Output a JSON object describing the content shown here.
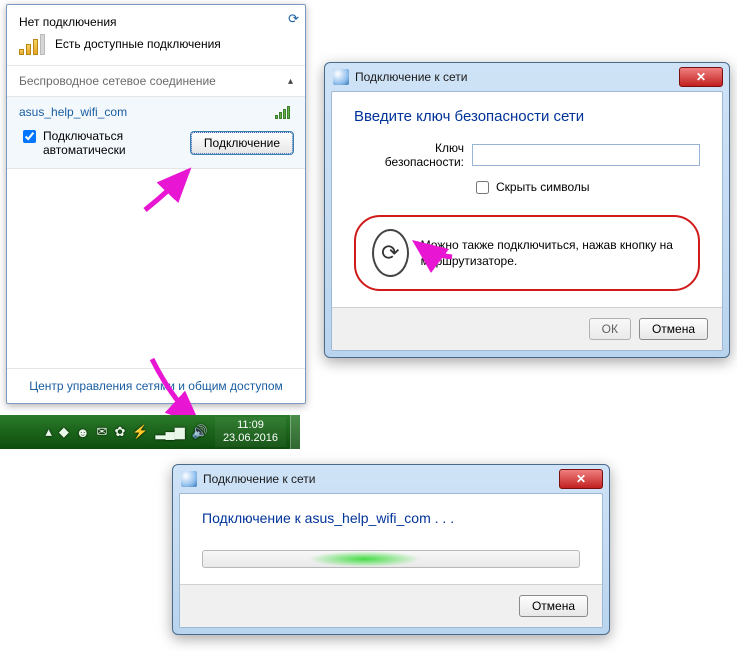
{
  "flyout": {
    "no_connection": "Нет подключения",
    "available": "Есть доступные подключения",
    "wireless_header": "Беспроводное сетевое соединение",
    "ssid": "asus_help_wifi_com",
    "auto_connect": "Подключаться\nавтоматически",
    "connect_btn": "Подключение",
    "footer_link": "Центр управления сетями и общим доступом"
  },
  "taskbar": {
    "time": "11:09",
    "date": "23.06.2016"
  },
  "security_dialog": {
    "title": "Подключение к сети",
    "heading": "Введите ключ безопасности сети",
    "key_label": "Ключ безопасности:",
    "hide_chars": "Скрыть символы",
    "router_text": "Можно также подключиться, нажав кнопку на маршрутизаторе.",
    "ok": "ОК",
    "cancel": "Отмена"
  },
  "progress_dialog": {
    "title": "Подключение к сети",
    "message": "Подключение к asus_help_wifi_com . . .",
    "cancel": "Отмена"
  }
}
